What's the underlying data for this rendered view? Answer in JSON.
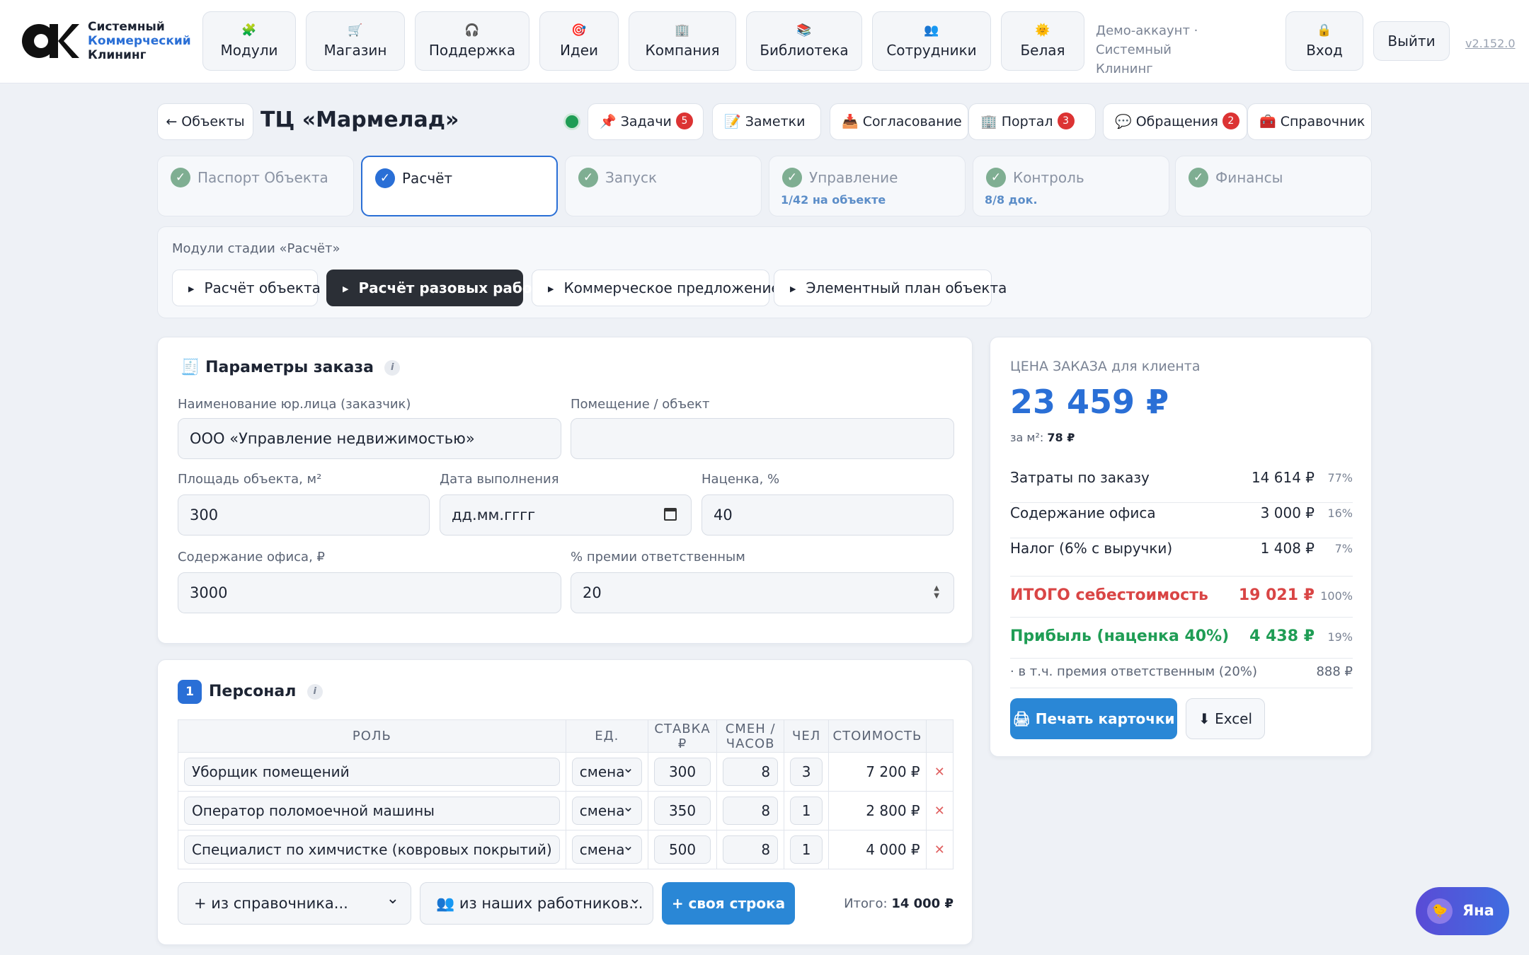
{
  "logo": {
    "line1": "Системный",
    "line2": "Коммерческий",
    "line3": "Клининг"
  },
  "nav": [
    {
      "label": "Модули",
      "icon": "🧩"
    },
    {
      "label": "Магазин",
      "icon": "🛒"
    },
    {
      "label": "Поддержка",
      "icon": "🎧"
    },
    {
      "label": "Идеи",
      "icon": "🎯"
    },
    {
      "label": "Компания",
      "icon": "🏢"
    },
    {
      "label": "Библиотека",
      "icon": "📚"
    },
    {
      "label": "Сотрудники",
      "icon": "👥"
    },
    {
      "label": "Белая",
      "icon": "🌞"
    },
    {
      "label": "Вход",
      "icon": "🔒"
    }
  ],
  "account": {
    "line1": "Демо-аккаунт · Системный",
    "line2": "Клининг"
  },
  "exit_label": "Выйти",
  "version": "v2.152.0",
  "object": {
    "back": "← Объекты",
    "title": "ТЦ «Мармелад»"
  },
  "toolbar": [
    {
      "label": "Задачи",
      "icon": "📌",
      "badge": "5"
    },
    {
      "label": "Заметки",
      "icon": "📝"
    },
    {
      "label": "Согласование",
      "icon": "📥"
    },
    {
      "label": "Портал",
      "icon": "🏢",
      "badge": "3"
    },
    {
      "label": "Обращения",
      "icon": "💬",
      "badge": "2"
    },
    {
      "label": "Справочник",
      "icon": "🧰"
    }
  ],
  "stages": [
    {
      "label": "Паспорт Объекта",
      "sub": ""
    },
    {
      "label": "Расчёт",
      "sub": ""
    },
    {
      "label": "Запуск",
      "sub": ""
    },
    {
      "label": "Управление",
      "sub": "1/42 на объекте"
    },
    {
      "label": "Контроль",
      "sub": "8/8 док."
    },
    {
      "label": "Финансы",
      "sub": ""
    }
  ],
  "modules": {
    "caption": "Модули стадии «Расчёт»",
    "items": [
      "Расчёт объекта",
      "Расчёт разовых работ",
      "Коммерческое предложение",
      "Элементный план объекта"
    ]
  },
  "params": {
    "title": "Параметры заказа",
    "icon": "🧾",
    "client_label": "Наименование юр.лица (заказчик)",
    "client_value": "ООО «Управление недвижимостью»",
    "room_label": "Помещение / объект",
    "room_value": "",
    "area_label": "Площадь объекта, м²",
    "area_value": "300",
    "date_label": "Дата выполнения",
    "date_value": "дд.мм.гггг",
    "markup_label": "Наценка, %",
    "markup_value": "40",
    "office_label": "Содержание офиса, ₽",
    "office_value": "3000",
    "bonus_label": "% премии ответственным",
    "bonus_value": "20"
  },
  "price": {
    "caption": "ЦЕНА ЗАКАЗА для клиента",
    "value": "23 459 ₽",
    "per_m2_label": "за м²:",
    "per_m2_value": "78 ₽",
    "rows": [
      {
        "k": "Затраты по заказу",
        "v": "14 614 ₽",
        "p": "77%"
      },
      {
        "k": "Содержание офиса",
        "v": "3 000 ₽",
        "p": "16%"
      },
      {
        "k": "Налог (6% с выручки)",
        "v": "1 408 ₽",
        "p": "7%"
      },
      {
        "k": "ИТОГО себестоимость",
        "v": "19 021 ₽",
        "p": "100%"
      },
      {
        "k": "Прибыль (наценка 40%)",
        "v": "4 438 ₽",
        "p": "19%"
      },
      {
        "k": "· в т.ч. премия ответственным (20%)",
        "v": "888 ₽",
        "p": ""
      }
    ],
    "print_label": "🖨 Печать карточки",
    "excel_label": "⬇ Excel",
    "colors": {
      "accent": "#2a6fd6",
      "loss": "#d94545",
      "profit": "#1f9d55"
    }
  },
  "staff": {
    "num": "1",
    "title": "Персонал",
    "headers": [
      "РОЛЬ",
      "ЕД.",
      "СТАВКА ₽",
      "СМЕН / ЧАСОВ",
      "ЧЕЛ",
      "СТОИМОСТЬ",
      ""
    ],
    "rows": [
      {
        "role": "Уборщик помещений",
        "unit": "смена",
        "rate": "300",
        "shifts": "8",
        "people": "3",
        "cost": "7 200 ₽"
      },
      {
        "role": "Оператор поломоечной машины",
        "unit": "смена",
        "rate": "350",
        "shifts": "8",
        "people": "1",
        "cost": "2 800 ₽"
      },
      {
        "role": "Специалист по химчистке (ковровых покрытий)",
        "unit": "смена",
        "rate": "500",
        "shifts": "8",
        "people": "1",
        "cost": "4 000 ₽"
      }
    ],
    "from_ref": "+ из справочника...",
    "from_workers": "👥 из наших работников...",
    "add_row": "+ своя строка",
    "total_label": "Итого:",
    "total_value": "14 000 ₽"
  },
  "assistant": {
    "name": "Яна",
    "icon": "🐤"
  }
}
